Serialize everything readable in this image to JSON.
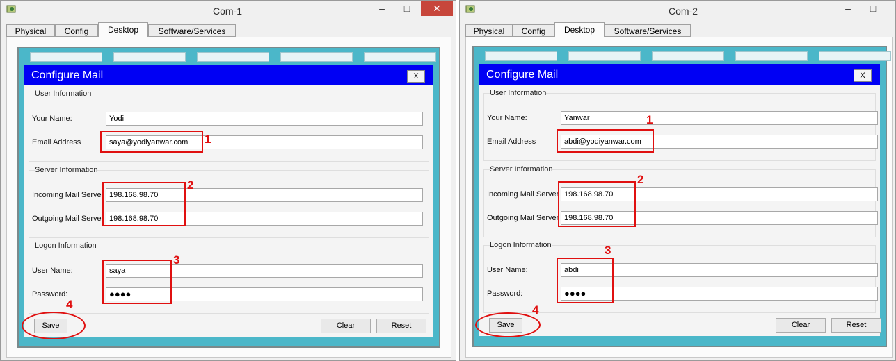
{
  "windows": [
    {
      "title": "Com-1",
      "controls": {
        "minimize": "–",
        "maximize": "□",
        "close": "✕"
      },
      "tabs": [
        "Physical",
        "Config",
        "Desktop",
        "Software/Services"
      ],
      "active_tab": "Desktop",
      "dialog": {
        "title": "Configure Mail",
        "close_label": "X",
        "user_info": {
          "group_label": "User Information",
          "name_label": "Your Name:",
          "name_value": "Yodi",
          "email_label": "Email Address",
          "email_value": "saya@yodiyanwar.com"
        },
        "server_info": {
          "group_label": "Server Information",
          "incoming_label": "Incoming Mail Server",
          "incoming_value": "198.168.98.70",
          "outgoing_label": "Outgoing Mail Server",
          "outgoing_value": "198.168.98.70"
        },
        "logon_info": {
          "group_label": "Logon Information",
          "user_label": "User Name:",
          "user_value": "saya",
          "password_label": "Password:",
          "password_value": "●●●●"
        },
        "buttons": {
          "save": "Save",
          "clear": "Clear",
          "reset": "Reset"
        }
      },
      "annotations": [
        "1",
        "2",
        "3",
        "4"
      ]
    },
    {
      "title": "Com-2",
      "controls": {
        "minimize": "–",
        "maximize": "□",
        "close": "✕"
      },
      "tabs": [
        "Physical",
        "Config",
        "Desktop",
        "Software/Services"
      ],
      "active_tab": "Desktop",
      "dialog": {
        "title": "Configure Mail",
        "close_label": "X",
        "user_info": {
          "group_label": "User Information",
          "name_label": "Your Name:",
          "name_value": "Yanwar",
          "email_label": "Email Address",
          "email_value": "abdi@yodiyanwar.com"
        },
        "server_info": {
          "group_label": "Server Information",
          "incoming_label": "Incoming Mail Server",
          "incoming_value": "198.168.98.70",
          "outgoing_label": "Outgoing Mail Server",
          "outgoing_value": "198.168.98.70"
        },
        "logon_info": {
          "group_label": "Logon Information",
          "user_label": "User Name:",
          "user_value": "abdi",
          "password_label": "Password:",
          "password_value": "●●●●"
        },
        "buttons": {
          "save": "Save",
          "clear": "Clear",
          "reset": "Reset"
        }
      },
      "annotations": [
        "1",
        "2",
        "3",
        "4"
      ]
    }
  ],
  "colors": {
    "dialog_header": "#0000f4",
    "desktop_bg": "#4bb7c9",
    "annotation": "#e01010",
    "close_button": "#c7463b"
  }
}
